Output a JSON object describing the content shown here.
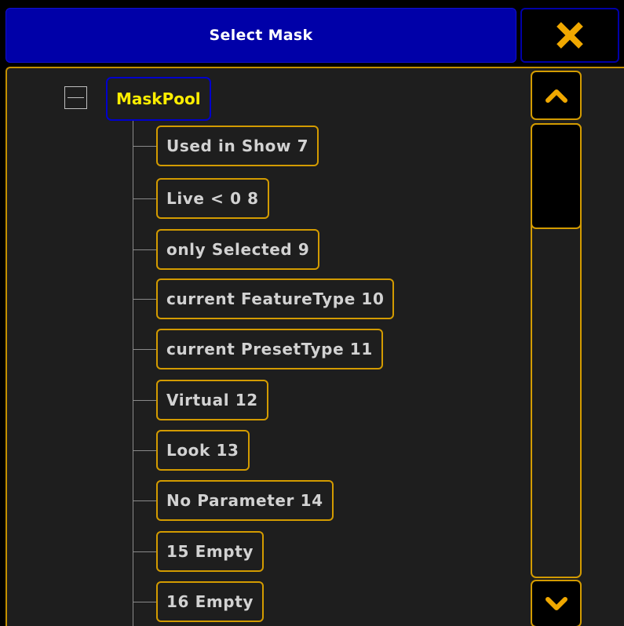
{
  "window": {
    "title": "Select Mask",
    "close_icon": "close-x-icon"
  },
  "tree": {
    "root": {
      "label": "MaskPool",
      "expanded": true
    },
    "children": [
      {
        "label": "Used in Show 7"
      },
      {
        "label": "Live < 0 8"
      },
      {
        "label": "only Selected 9"
      },
      {
        "label": "current FeatureType 10"
      },
      {
        "label": "current PresetType 11"
      },
      {
        "label": "Virtual 12"
      },
      {
        "label": "Look 13"
      },
      {
        "label": "No Parameter 14"
      },
      {
        "label": "15 Empty"
      },
      {
        "label": "16 Empty"
      }
    ]
  },
  "scrollbar": {
    "up_icon": "chevron-up-icon",
    "down_icon": "chevron-down-icon"
  },
  "colors": {
    "title_bar": "#0000a8",
    "accent": "#d39b00",
    "root_label": "#ffee00",
    "node_text": "#d2d2d2",
    "panel_bg": "#1e1e1e"
  }
}
